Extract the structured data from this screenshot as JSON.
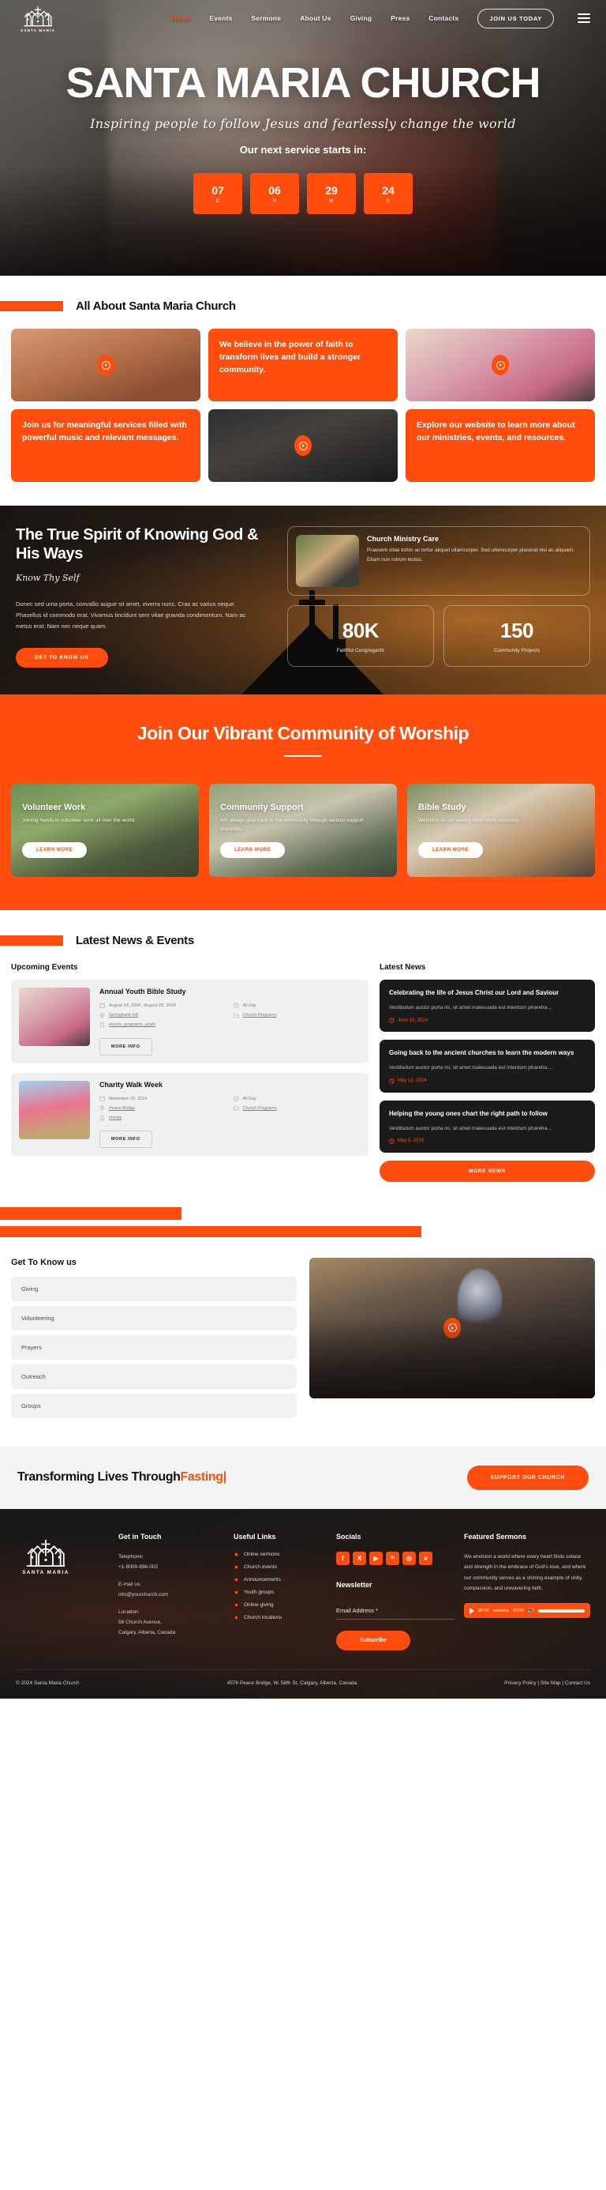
{
  "header": {
    "logo_text": "SANTA MARIA",
    "nav": [
      {
        "label": "Home",
        "active": true
      },
      {
        "label": "Events",
        "active": false
      },
      {
        "label": "Sermons",
        "active": false
      },
      {
        "label": "About Us",
        "active": false
      },
      {
        "label": "Giving",
        "active": false
      },
      {
        "label": "Press",
        "active": false
      },
      {
        "label": "Contacts",
        "active": false
      }
    ],
    "cta_label": "JOIN US TODAY"
  },
  "hero": {
    "title": "SANTA MARIA CHURCH",
    "subtitle": "Inspiring people to follow Jesus and fearlessly change the world",
    "countdown_label": "Our next service starts in:",
    "countdown": [
      {
        "value": "07",
        "unit": "D"
      },
      {
        "value": "06",
        "unit": "H"
      },
      {
        "value": "29",
        "unit": "M"
      },
      {
        "value": "24",
        "unit": "S"
      }
    ]
  },
  "about": {
    "title": "All About Santa Maria Church",
    "tiles": [
      {
        "kind": "image",
        "art": "ph-church",
        "alt": "church-interior-photo"
      },
      {
        "kind": "text",
        "text": "We believe in the power of faith to transform lives and build a stronger community."
      },
      {
        "kind": "image",
        "art": "ph-kids",
        "alt": "children-reading-photo"
      },
      {
        "kind": "text",
        "text": "Join us for meaningful services filled with powerful music and relevant messages."
      },
      {
        "kind": "image",
        "art": "ph-candle",
        "alt": "candles-photo"
      },
      {
        "kind": "text",
        "text": "Explore our website to learn more about our ministries, events, and resources."
      }
    ]
  },
  "spirit": {
    "heading": "The True Spirit of Knowing God & His Ways",
    "script": "Know Thy Self",
    "paragraph": "Donec sed urna porta, convallis augue sit amet, viverra nunc. Cras ac varius neque. Phasellus id commodo erat. Vivamus tincidunt sem vitae gravida condimentum. Nam ac metus erat. Nam nec neque quam.",
    "button": "GET TO KNOW US",
    "ministry": {
      "title": "Church Ministry Care",
      "text": "Praesent vitae tortor ac tortor aliquet ullamcorper. Sed ullamcorper placerat nisi ac aliquam. Etiam non rutrum lectus."
    },
    "stats": [
      {
        "number": "80K",
        "label": "Faithful Congregants"
      },
      {
        "number": "150",
        "label": "Community Projects"
      }
    ]
  },
  "vibrant": {
    "heading": "Join Our Vibrant Community of Worship",
    "cards": [
      {
        "title": "Volunteer Work",
        "desc": "Joining hands in volunteer work all over the world.",
        "button": "LEARN MORE"
      },
      {
        "title": "Community Support",
        "desc": "We always give back to the community through various support channels.",
        "button": "LEARN MORE"
      },
      {
        "title": "Bible Study",
        "desc": "Welcome to our weekly bible study sessions.",
        "button": "LEARN MORE"
      }
    ]
  },
  "news_events": {
    "title": "Latest News & Events",
    "events_heading": "Upcoming Events",
    "news_heading": "Latest News",
    "events": [
      {
        "title": "Annual Youth Bible Study",
        "date": "August 24, 2024 - August 26, 2024",
        "time": "All Day",
        "location": "Springbank Hill",
        "category": "Church Programs",
        "tags": "events, programs, youth",
        "button": "MORE INFO"
      },
      {
        "title": "Charity Walk Week",
        "date": "November 20, 2024",
        "time": "All Day",
        "location": "Peace Bridge",
        "category": "Church Programs",
        "tags": "charity",
        "button": "MORE INFO"
      }
    ],
    "news": [
      {
        "title": "Celebrating the life of Jesus Christ our Lord and Saviour",
        "excerpt": "Vestibulum auctor porta mi, sit amet malesuada est interdum pharetra....",
        "date": "June 15, 2024"
      },
      {
        "title": "Going back to the ancient churches to learn the modern ways",
        "excerpt": "Vestibulum auctor porta mi, sit amet malesuada est interdum pharetra....",
        "date": "May 12, 2024"
      },
      {
        "title": "Helping the young ones chart the right path to follow",
        "excerpt": "Vestibulum auctor porta mi, sit amet malesuada est interdum pharetra....",
        "date": "May 5, 2024"
      }
    ],
    "more_news_button": "MORE NEWS"
  },
  "get_to_know": {
    "heading": "Get To Know us",
    "items": [
      "Giving",
      "Volunteering",
      "Prayers",
      "Outreach",
      "Groups"
    ]
  },
  "cta": {
    "text_plain": "Transforming Lives Through",
    "text_highlight": "Fasting|",
    "button": "SUPPORT OUR CHURCH"
  },
  "footer": {
    "logo_text": "SANTA MARIA",
    "get_in_touch": {
      "heading": "Get in Touch",
      "telephone_label": "Telephone:",
      "telephone": "+1-9008-898-002",
      "email_label": "E-mail us:",
      "email": "info@yourchurch.com",
      "location_label": "Location:",
      "location_line1": "58 Church Avenue,",
      "location_line2": "Calgary, Alberta, Canada"
    },
    "useful_links": {
      "heading": "Useful Links",
      "items": [
        "Online sermons",
        "Church events",
        "Announcements",
        "Youth groups",
        "Online giving",
        "Church locations"
      ]
    },
    "socials": {
      "heading": "Socials",
      "items": [
        {
          "name": "facebook-icon",
          "glyph": "f"
        },
        {
          "name": "x-twitter-icon",
          "glyph": "X"
        },
        {
          "name": "youtube-icon",
          "glyph": "▶"
        },
        {
          "name": "linkedin-icon",
          "glyph": "in"
        },
        {
          "name": "whatsapp-icon",
          "glyph": "◎"
        },
        {
          "name": "vimeo-icon",
          "glyph": "v"
        }
      ]
    },
    "newsletter": {
      "heading": "Newsletter",
      "placeholder": "Email Address *",
      "button": "Subscribe"
    },
    "featured_sermons": {
      "heading": "Featured Sermons",
      "text": "We envision a world where every heart finds solace and strength in the embrace of God's love, and where our community serves as a shining example of unity, compassion, and unwavering faith.",
      "player_current": "00:00",
      "player_total": "00:00"
    },
    "bottom": {
      "copyright": "© 2024 Santa Maria Church",
      "address": "4576 Peace Bridge, W. 58th St, Calgary, Alberta, Canada",
      "links": "Privacy Policy | Site Map | Contact Us"
    }
  },
  "colors": {
    "accent": "#ff4d0d",
    "dark": "#181818",
    "light_gray": "#f1f1f1"
  }
}
